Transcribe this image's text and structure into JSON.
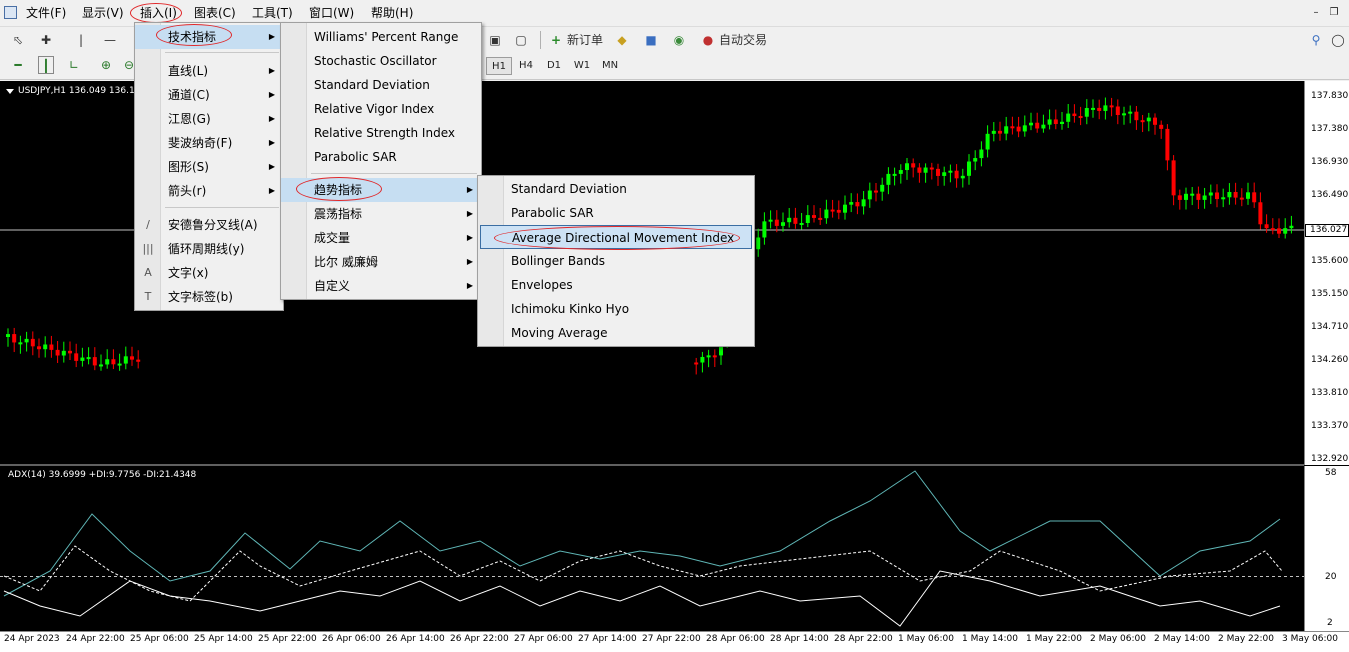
{
  "menubar": {
    "items": [
      {
        "label": "文件(F)"
      },
      {
        "label": "显示(V)"
      },
      {
        "label": "插入(I)"
      },
      {
        "label": "图表(C)"
      },
      {
        "label": "工具(T)"
      },
      {
        "label": "窗口(W)"
      },
      {
        "label": "帮助(H)"
      }
    ]
  },
  "toolbar": {
    "new_order_label": "新订单",
    "auto_trade_label": "自动交易",
    "timeframes": [
      "H1",
      "H4",
      "D1",
      "W1",
      "MN"
    ]
  },
  "chart": {
    "title": "USDJPY,H1  136.049 136.1",
    "current_price": "136.027",
    "price_labels": [
      "137.830",
      "137.380",
      "136.930",
      "136.490",
      "136.027",
      "135.600",
      "135.150",
      "134.710",
      "134.260",
      "133.810",
      "133.370",
      "132.920"
    ],
    "indicator_title": "ADX(14) 39.6999 +DI:9.7756 -DI:21.4348",
    "indicator_levels": [
      "58",
      "20",
      "2"
    ],
    "time_labels": [
      "24 Apr 2023",
      "24 Apr 22:00",
      "25 Apr 06:00",
      "25 Apr 14:00",
      "25 Apr 22:00",
      "26 Apr 06:00",
      "26 Apr 14:00",
      "26 Apr 22:00",
      "27 Apr 06:00",
      "27 Apr 14:00",
      "27 Apr 22:00",
      "28 Apr 06:00",
      "28 Apr 14:00",
      "28 Apr 22:00",
      "1 May 06:00",
      "1 May 14:00",
      "1 May 22:00",
      "2 May 06:00",
      "2 May 14:00",
      "2 May 22:00",
      "3 May 06:00"
    ],
    "colors": {
      "bull": "#00ff00",
      "bear": "#ff0000",
      "background": "#000000",
      "adx_line": "#5fb6b6",
      "di_lines": "#ffffff"
    }
  },
  "insert_menu": {
    "items": [
      {
        "label": "技术指标",
        "icon": "",
        "has_submenu": true
      },
      {
        "label": "直线(L)",
        "icon": "",
        "has_submenu": true
      },
      {
        "label": "通道(C)",
        "icon": "",
        "has_submenu": true
      },
      {
        "label": "江恩(G)",
        "icon": "",
        "has_submenu": true
      },
      {
        "label": "斐波纳奇(F)",
        "icon": "",
        "has_submenu": true
      },
      {
        "label": "图形(S)",
        "icon": "",
        "has_submenu": true
      },
      {
        "label": "箭头(r)",
        "icon": "",
        "has_submenu": true
      },
      {
        "label": "安德鲁分叉线(A)",
        "icon": "pitchfork-icon",
        "has_submenu": false
      },
      {
        "label": "循环周期线(y)",
        "icon": "cycle-lines-icon",
        "has_submenu": false
      },
      {
        "label": "文字(x)",
        "icon": "text-icon",
        "has_submenu": false
      },
      {
        "label": "文字标签(b)",
        "icon": "text-label-icon",
        "has_submenu": false
      }
    ]
  },
  "indicators_menu": {
    "items": [
      {
        "label": "Williams' Percent Range",
        "has_submenu": false
      },
      {
        "label": "Stochastic Oscillator",
        "has_submenu": false
      },
      {
        "label": "Standard Deviation",
        "has_submenu": false
      },
      {
        "label": "Relative Vigor Index",
        "has_submenu": false
      },
      {
        "label": "Relative Strength Index",
        "has_submenu": false
      },
      {
        "label": "Parabolic SAR",
        "has_submenu": false
      },
      {
        "label": "趋势指标",
        "has_submenu": true
      },
      {
        "label": "震荡指标",
        "has_submenu": true
      },
      {
        "label": "成交量",
        "has_submenu": true
      },
      {
        "label": "比尔 威廉姆",
        "has_submenu": true
      },
      {
        "label": "自定义",
        "has_submenu": true
      }
    ]
  },
  "trend_menu": {
    "items": [
      {
        "label": "Standard Deviation"
      },
      {
        "label": "Parabolic SAR"
      },
      {
        "label": "Average Directional Movement Index"
      },
      {
        "label": "Bollinger Bands"
      },
      {
        "label": "Envelopes"
      },
      {
        "label": "Ichimoku Kinko Hyo"
      },
      {
        "label": "Moving Average"
      }
    ],
    "selected_index": 2
  }
}
